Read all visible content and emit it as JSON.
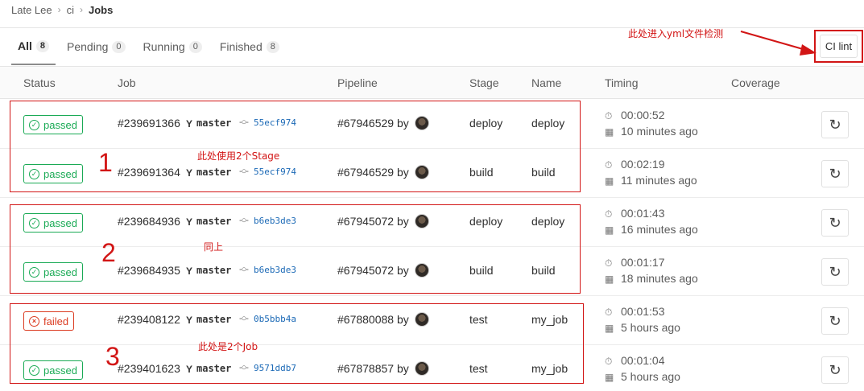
{
  "breadcrumb": {
    "group": "Late Lee",
    "project": "ci",
    "current": "Jobs",
    "sep": "›"
  },
  "tabs": [
    {
      "label": "All",
      "count": "8",
      "active": true
    },
    {
      "label": "Pending",
      "count": "0"
    },
    {
      "label": "Running",
      "count": "0"
    },
    {
      "label": "Finished",
      "count": "8"
    }
  ],
  "ci_lint_label": "CI lint",
  "columns": {
    "status": "Status",
    "job": "Job",
    "pipeline": "Pipeline",
    "stage": "Stage",
    "name": "Name",
    "timing": "Timing",
    "coverage": "Coverage"
  },
  "rows": [
    {
      "status": "passed",
      "job": "#239691366",
      "branch": "master",
      "sha": "55ecf974",
      "pipeline": "#67946529 by",
      "stage": "deploy",
      "name": "deploy",
      "duration": "00:00:52",
      "ago": "10 minutes ago"
    },
    {
      "status": "passed",
      "job": "#239691364",
      "branch": "master",
      "sha": "55ecf974",
      "pipeline": "#67946529 by",
      "stage": "build",
      "name": "build",
      "duration": "00:02:19",
      "ago": "11 minutes ago"
    },
    {
      "status": "passed",
      "job": "#239684936",
      "branch": "master",
      "sha": "b6eb3de3",
      "pipeline": "#67945072 by",
      "stage": "deploy",
      "name": "deploy",
      "duration": "00:01:43",
      "ago": "16 minutes ago"
    },
    {
      "status": "passed",
      "job": "#239684935",
      "branch": "master",
      "sha": "b6eb3de3",
      "pipeline": "#67945072 by",
      "stage": "build",
      "name": "build",
      "duration": "00:01:17",
      "ago": "18 minutes ago"
    },
    {
      "status": "failed",
      "job": "#239408122",
      "branch": "master",
      "sha": "0b5bbb4a",
      "pipeline": "#67880088 by",
      "stage": "test",
      "name": "my_job",
      "duration": "00:01:53",
      "ago": "5 hours ago"
    },
    {
      "status": "passed",
      "job": "#239401623",
      "branch": "master",
      "sha": "9571ddb7",
      "pipeline": "#67878857 by",
      "stage": "test",
      "name": "my_job",
      "duration": "00:01:04",
      "ago": "5 hours ago"
    }
  ],
  "annotations": {
    "lint_note": "此处进入yml文件检测",
    "group1_num": "1",
    "group1_note": "此处使用2个Stage",
    "group2_num": "2",
    "group2_note": "同上",
    "group3_num": "3",
    "group3_note": "此处是2个Job",
    "color": "#d21515"
  },
  "colors": {
    "passed": "#1aaa55",
    "failed": "#db3b21",
    "link": "#1b69b6"
  },
  "icons": {
    "branch": "branch-icon",
    "commit": "commit-icon",
    "timer": "timer-icon",
    "calendar": "calendar-icon",
    "retry": "retry-icon"
  }
}
